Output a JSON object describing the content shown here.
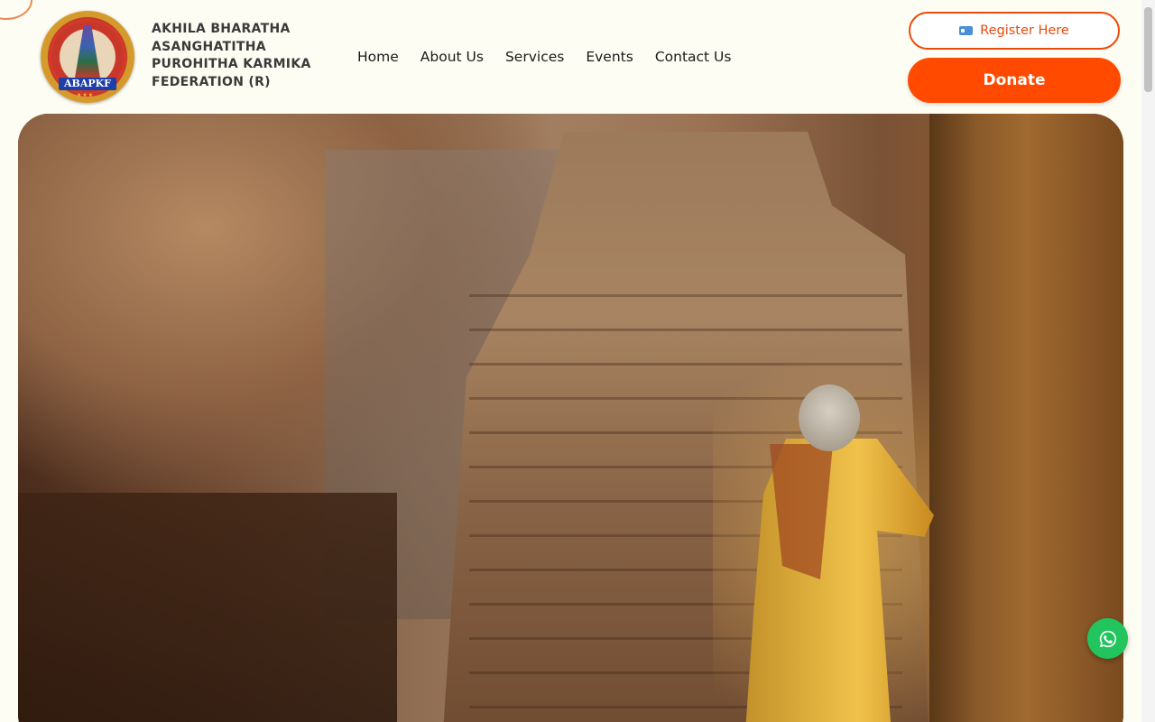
{
  "org": {
    "name_lines": [
      "AKHILA BHARATHA",
      "ASANGHATITHA",
      "PUROHITHA KARMIKA",
      "FEDERATION (R)"
    ],
    "logo_text": "ABAPKF"
  },
  "nav": {
    "items": [
      {
        "label": "Home"
      },
      {
        "label": "About Us"
      },
      {
        "label": "Services"
      },
      {
        "label": "Events"
      },
      {
        "label": "Contact Us"
      }
    ]
  },
  "actions": {
    "register_label": "Register Here",
    "register_icon": "id-card-icon",
    "donate_label": "Donate"
  },
  "hero": {
    "image": "temple-cave-photo"
  },
  "floating": {
    "whatsapp_icon": "whatsapp-icon"
  },
  "colors": {
    "accent": "#ff4a00",
    "register_border": "#ea4b0d",
    "whatsapp": "#22c45e",
    "background": "#fefdf3"
  }
}
